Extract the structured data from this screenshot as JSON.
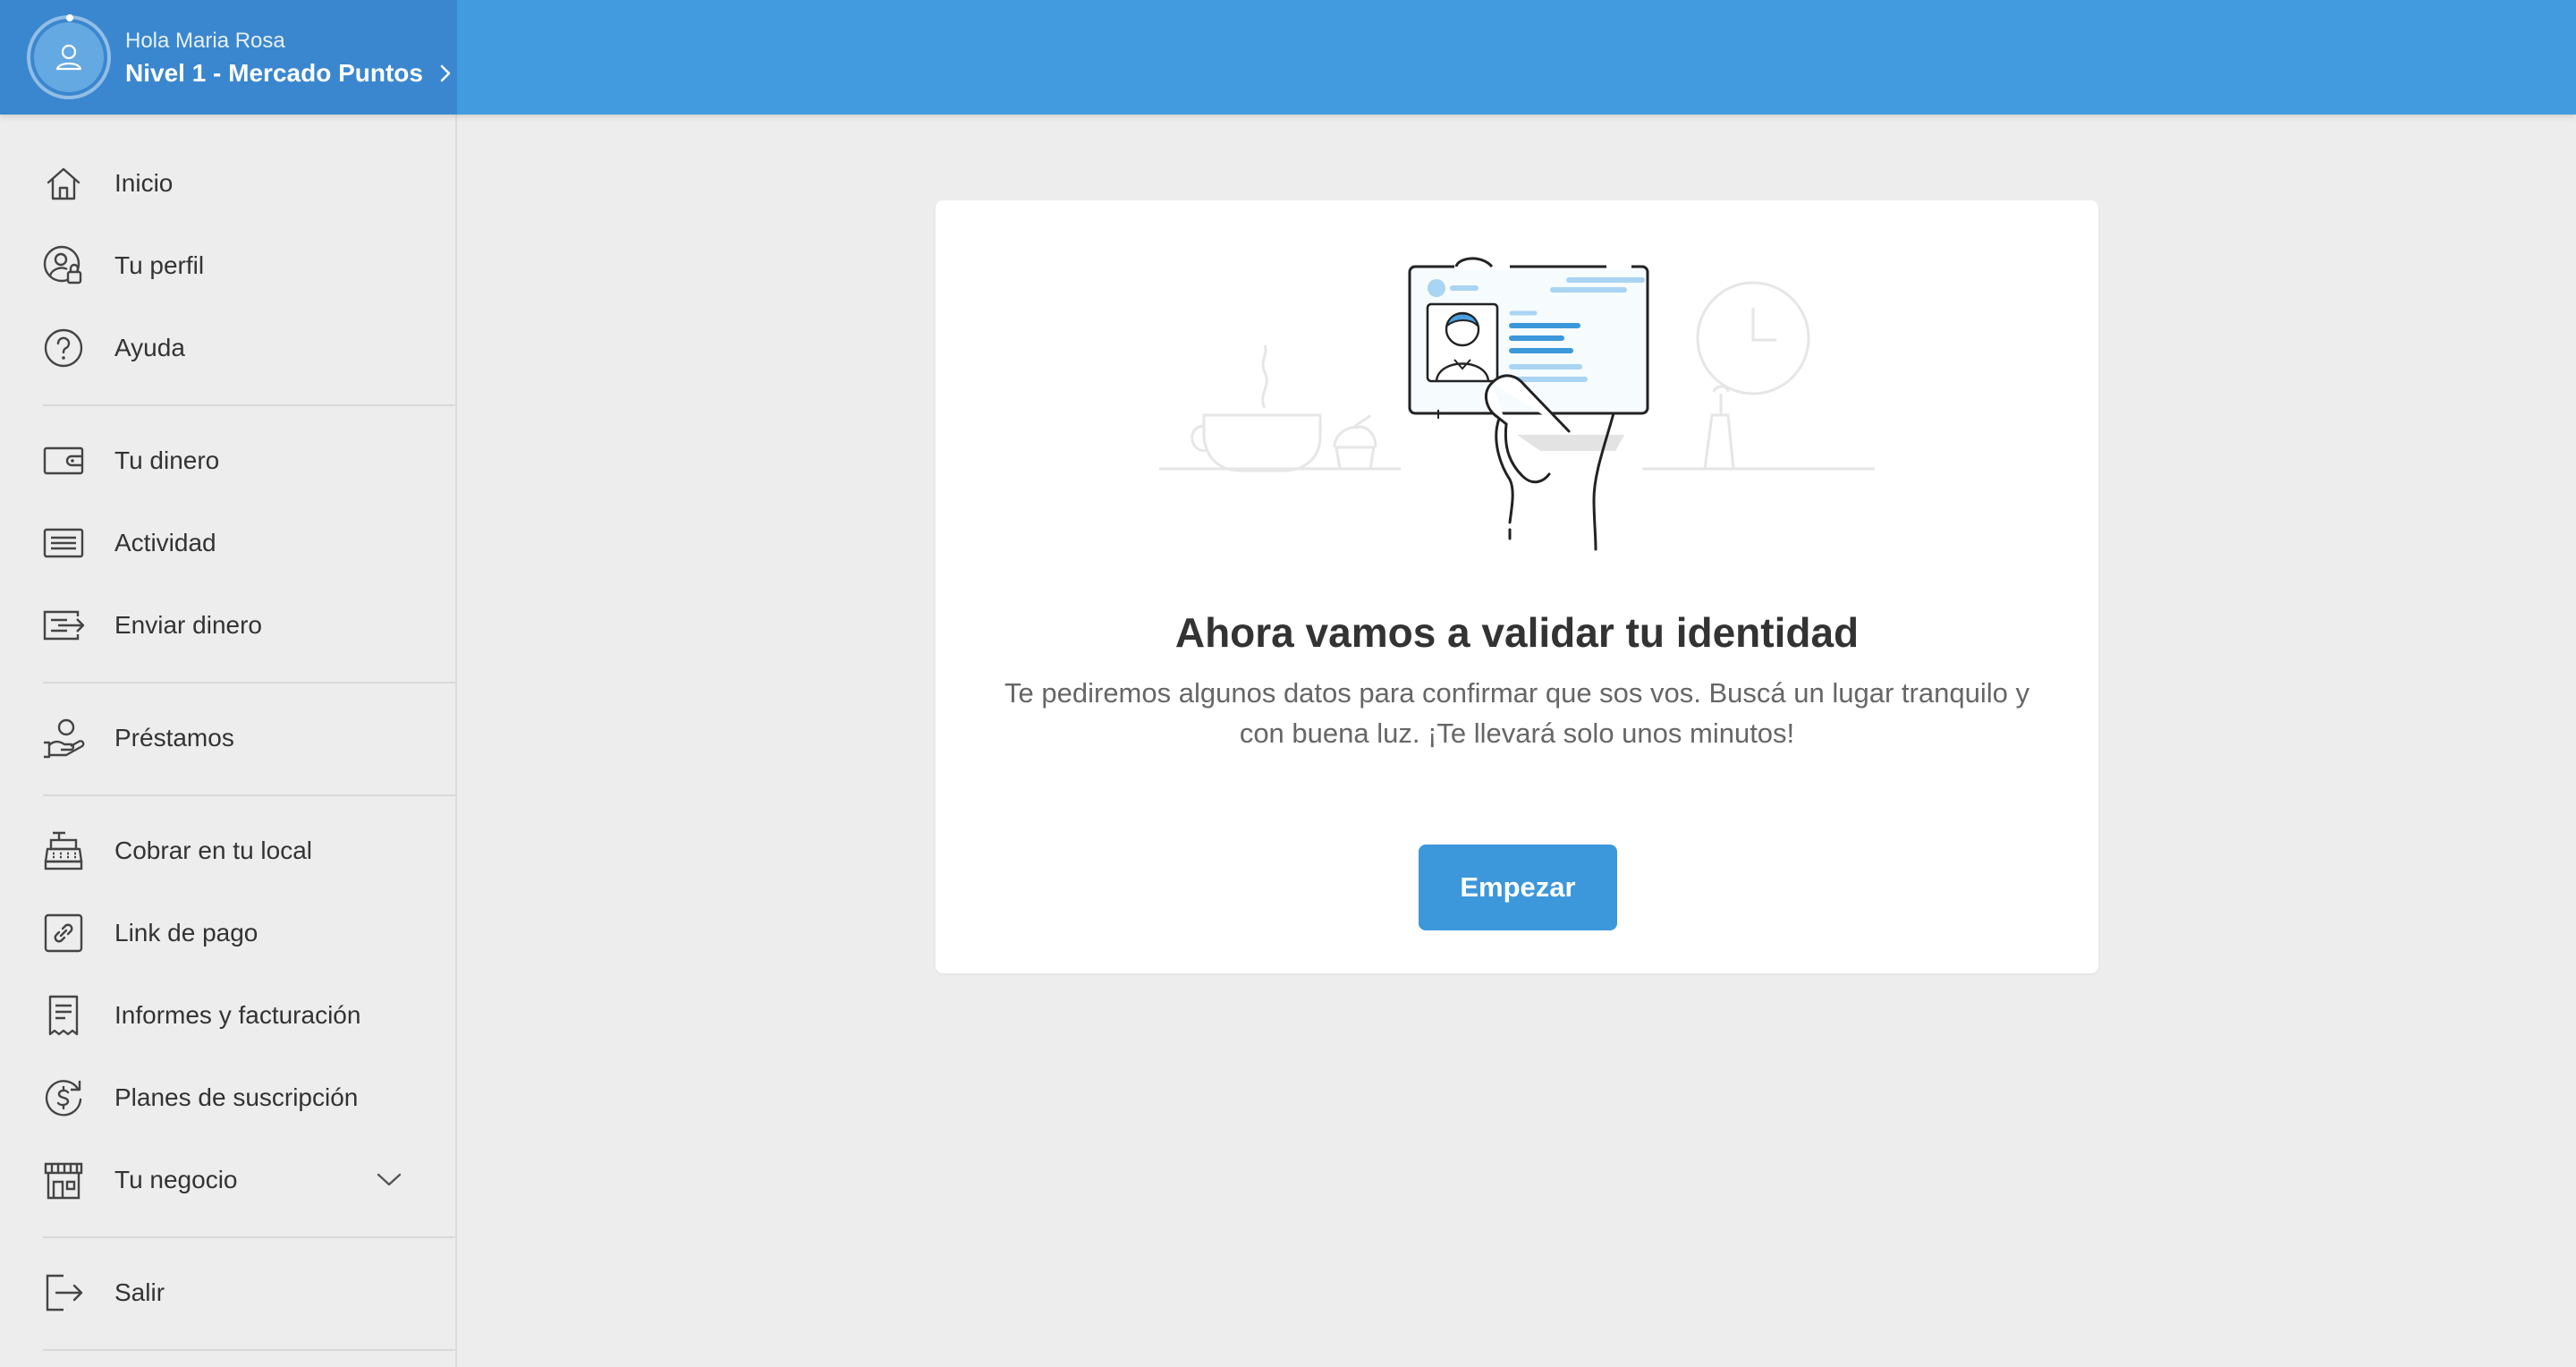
{
  "header": {
    "greeting": "Hola Maria Rosa",
    "level": "Nivel 1 - Mercado Puntos",
    "accent_color": "#419bde"
  },
  "sidebar": {
    "items": [
      {
        "label": "Inicio",
        "icon": "home-icon"
      },
      {
        "label": "Tu perfil",
        "icon": "user-lock-icon"
      },
      {
        "label": "Ayuda",
        "icon": "help-icon"
      },
      {
        "label": "Tu dinero",
        "icon": "wallet-icon"
      },
      {
        "label": "Actividad",
        "icon": "activity-icon"
      },
      {
        "label": "Enviar dinero",
        "icon": "send-money-icon"
      },
      {
        "label": "Préstamos",
        "icon": "loan-icon"
      },
      {
        "label": "Cobrar en tu local",
        "icon": "cash-register-icon"
      },
      {
        "label": "Link de pago",
        "icon": "payment-link-icon"
      },
      {
        "label": "Informes y facturación",
        "icon": "receipt-icon"
      },
      {
        "label": "Planes de suscripción",
        "icon": "subscription-icon"
      },
      {
        "label": "Tu negocio",
        "icon": "store-icon"
      },
      {
        "label": "Salir",
        "icon": "logout-icon"
      }
    ]
  },
  "main": {
    "title": "Ahora vamos a validar tu identidad",
    "description": "Te pediremos algunos datos para confirmar que sos vos. Buscá un lugar tranquilo y con buena luz. ¡Te llevará solo unos minutos!",
    "button_label": "Empezar",
    "illustration": "hand-holding-id-card-illustration",
    "button_color": "#3d97db"
  }
}
